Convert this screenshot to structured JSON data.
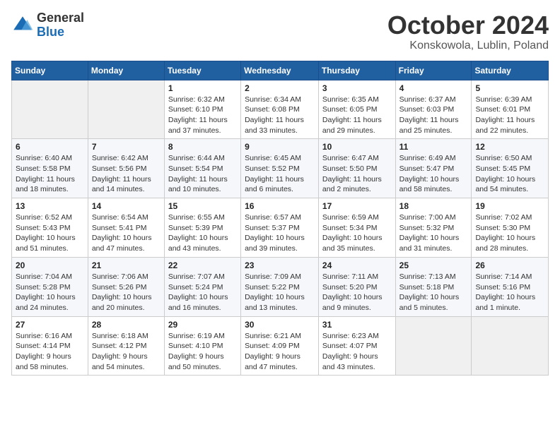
{
  "header": {
    "logo_general": "General",
    "logo_blue": "Blue",
    "month_title": "October 2024",
    "location": "Konskowola, Lublin, Poland"
  },
  "weekdays": [
    "Sunday",
    "Monday",
    "Tuesday",
    "Wednesday",
    "Thursday",
    "Friday",
    "Saturday"
  ],
  "weeks": [
    [
      {
        "day": "",
        "content": ""
      },
      {
        "day": "",
        "content": ""
      },
      {
        "day": "1",
        "content": "Sunrise: 6:32 AM\nSunset: 6:10 PM\nDaylight: 11 hours and 37 minutes."
      },
      {
        "day": "2",
        "content": "Sunrise: 6:34 AM\nSunset: 6:08 PM\nDaylight: 11 hours and 33 minutes."
      },
      {
        "day": "3",
        "content": "Sunrise: 6:35 AM\nSunset: 6:05 PM\nDaylight: 11 hours and 29 minutes."
      },
      {
        "day": "4",
        "content": "Sunrise: 6:37 AM\nSunset: 6:03 PM\nDaylight: 11 hours and 25 minutes."
      },
      {
        "day": "5",
        "content": "Sunrise: 6:39 AM\nSunset: 6:01 PM\nDaylight: 11 hours and 22 minutes."
      }
    ],
    [
      {
        "day": "6",
        "content": "Sunrise: 6:40 AM\nSunset: 5:58 PM\nDaylight: 11 hours and 18 minutes."
      },
      {
        "day": "7",
        "content": "Sunrise: 6:42 AM\nSunset: 5:56 PM\nDaylight: 11 hours and 14 minutes."
      },
      {
        "day": "8",
        "content": "Sunrise: 6:44 AM\nSunset: 5:54 PM\nDaylight: 11 hours and 10 minutes."
      },
      {
        "day": "9",
        "content": "Sunrise: 6:45 AM\nSunset: 5:52 PM\nDaylight: 11 hours and 6 minutes."
      },
      {
        "day": "10",
        "content": "Sunrise: 6:47 AM\nSunset: 5:50 PM\nDaylight: 11 hours and 2 minutes."
      },
      {
        "day": "11",
        "content": "Sunrise: 6:49 AM\nSunset: 5:47 PM\nDaylight: 10 hours and 58 minutes."
      },
      {
        "day": "12",
        "content": "Sunrise: 6:50 AM\nSunset: 5:45 PM\nDaylight: 10 hours and 54 minutes."
      }
    ],
    [
      {
        "day": "13",
        "content": "Sunrise: 6:52 AM\nSunset: 5:43 PM\nDaylight: 10 hours and 51 minutes."
      },
      {
        "day": "14",
        "content": "Sunrise: 6:54 AM\nSunset: 5:41 PM\nDaylight: 10 hours and 47 minutes."
      },
      {
        "day": "15",
        "content": "Sunrise: 6:55 AM\nSunset: 5:39 PM\nDaylight: 10 hours and 43 minutes."
      },
      {
        "day": "16",
        "content": "Sunrise: 6:57 AM\nSunset: 5:37 PM\nDaylight: 10 hours and 39 minutes."
      },
      {
        "day": "17",
        "content": "Sunrise: 6:59 AM\nSunset: 5:34 PM\nDaylight: 10 hours and 35 minutes."
      },
      {
        "day": "18",
        "content": "Sunrise: 7:00 AM\nSunset: 5:32 PM\nDaylight: 10 hours and 31 minutes."
      },
      {
        "day": "19",
        "content": "Sunrise: 7:02 AM\nSunset: 5:30 PM\nDaylight: 10 hours and 28 minutes."
      }
    ],
    [
      {
        "day": "20",
        "content": "Sunrise: 7:04 AM\nSunset: 5:28 PM\nDaylight: 10 hours and 24 minutes."
      },
      {
        "day": "21",
        "content": "Sunrise: 7:06 AM\nSunset: 5:26 PM\nDaylight: 10 hours and 20 minutes."
      },
      {
        "day": "22",
        "content": "Sunrise: 7:07 AM\nSunset: 5:24 PM\nDaylight: 10 hours and 16 minutes."
      },
      {
        "day": "23",
        "content": "Sunrise: 7:09 AM\nSunset: 5:22 PM\nDaylight: 10 hours and 13 minutes."
      },
      {
        "day": "24",
        "content": "Sunrise: 7:11 AM\nSunset: 5:20 PM\nDaylight: 10 hours and 9 minutes."
      },
      {
        "day": "25",
        "content": "Sunrise: 7:13 AM\nSunset: 5:18 PM\nDaylight: 10 hours and 5 minutes."
      },
      {
        "day": "26",
        "content": "Sunrise: 7:14 AM\nSunset: 5:16 PM\nDaylight: 10 hours and 1 minute."
      }
    ],
    [
      {
        "day": "27",
        "content": "Sunrise: 6:16 AM\nSunset: 4:14 PM\nDaylight: 9 hours and 58 minutes."
      },
      {
        "day": "28",
        "content": "Sunrise: 6:18 AM\nSunset: 4:12 PM\nDaylight: 9 hours and 54 minutes."
      },
      {
        "day": "29",
        "content": "Sunrise: 6:19 AM\nSunset: 4:10 PM\nDaylight: 9 hours and 50 minutes."
      },
      {
        "day": "30",
        "content": "Sunrise: 6:21 AM\nSunset: 4:09 PM\nDaylight: 9 hours and 47 minutes."
      },
      {
        "day": "31",
        "content": "Sunrise: 6:23 AM\nSunset: 4:07 PM\nDaylight: 9 hours and 43 minutes."
      },
      {
        "day": "",
        "content": ""
      },
      {
        "day": "",
        "content": ""
      }
    ]
  ]
}
